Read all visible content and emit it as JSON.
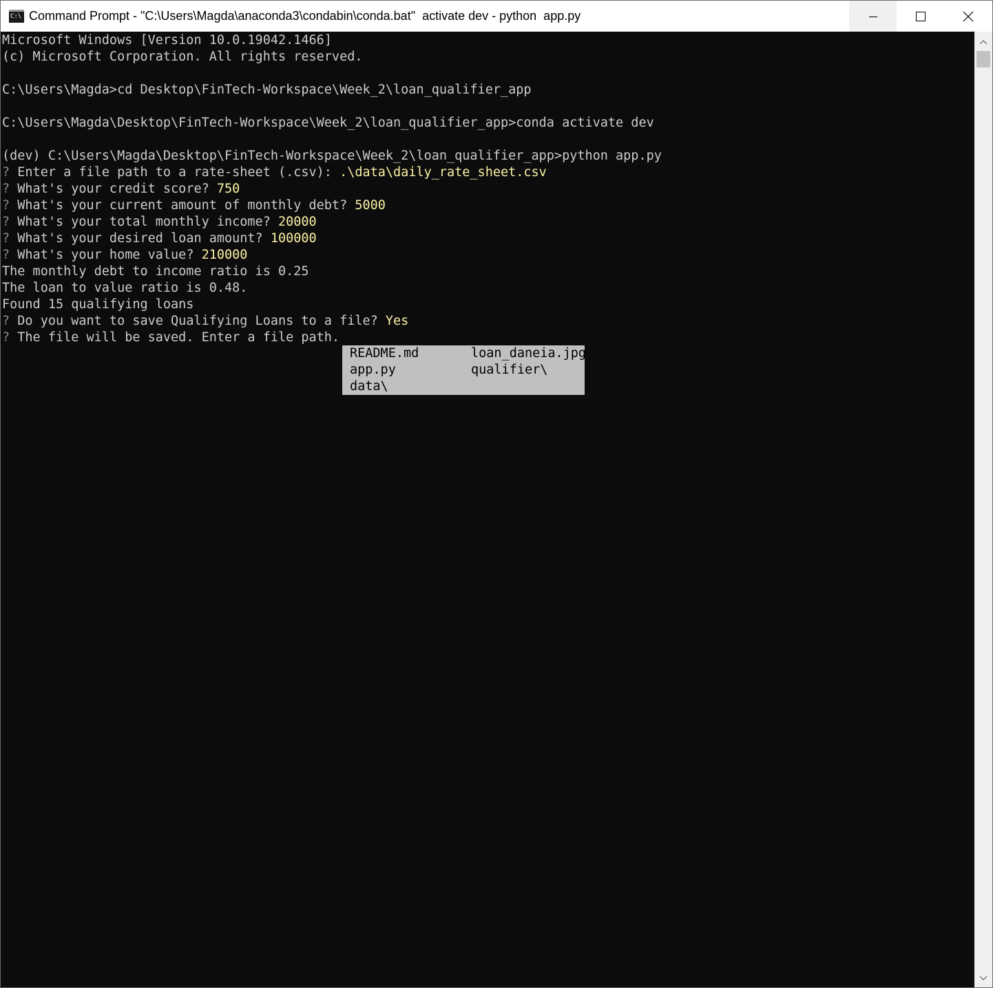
{
  "window": {
    "title": "Command Prompt - \"C:\\Users\\Magda\\anaconda3\\condabin\\conda.bat\"  activate dev - python  app.py",
    "icon_text": "C:\\",
    "minimize_icon": "minimize-icon",
    "maximize_icon": "maximize-icon",
    "close_icon": "close-icon"
  },
  "console": {
    "lines": [
      {
        "text": "Microsoft Windows [Version 10.0.19042.1466]"
      },
      {
        "text": "(c) Microsoft Corporation. All rights reserved."
      },
      {
        "text": ""
      },
      {
        "text": "C:\\Users\\Magda>cd Desktop\\FinTech-Workspace\\Week_2\\loan_qualifier_app"
      },
      {
        "text": ""
      },
      {
        "text": "C:\\Users\\Magda\\Desktop\\FinTech-Workspace\\Week_2\\loan_qualifier_app>conda activate dev"
      },
      {
        "text": ""
      },
      {
        "text": "(dev) C:\\Users\\Magda\\Desktop\\FinTech-Workspace\\Week_2\\loan_qualifier_app>python app.py"
      },
      {
        "marker": "?",
        "prompt": " Enter a file path to a rate-sheet (.csv): ",
        "answer": ".\\data\\daily_rate_sheet.csv"
      },
      {
        "marker": "?",
        "prompt": " What's your credit score? ",
        "answer": "750"
      },
      {
        "marker": "?",
        "prompt": " What's your current amount of monthly debt? ",
        "answer": "5000"
      },
      {
        "marker": "?",
        "prompt": " What's your total monthly income? ",
        "answer": "20000"
      },
      {
        "marker": "?",
        "prompt": " What's your desired loan amount? ",
        "answer": "100000"
      },
      {
        "marker": "?",
        "prompt": " What's your home value? ",
        "answer": "210000"
      },
      {
        "text": "The monthly debt to income ratio is 0.25"
      },
      {
        "text": "The loan to value ratio is 0.48."
      },
      {
        "text": "Found 15 qualifying loans"
      },
      {
        "marker": "?",
        "prompt": " Do you want to save Qualifying Loans to a file? ",
        "answer": "Yes"
      },
      {
        "marker": "?",
        "prompt": " The file will be saved. Enter a file path.",
        "answer": ""
      }
    ],
    "colors": {
      "background": "#0c0c0c",
      "text": "#cccccc",
      "answer": "#f9f1a5",
      "marker": "#8a8a8a"
    }
  },
  "autocomplete": {
    "items": [
      "README.md",
      "loan_daneia.jpg",
      "app.py",
      "qualifier\\",
      "data\\"
    ]
  }
}
